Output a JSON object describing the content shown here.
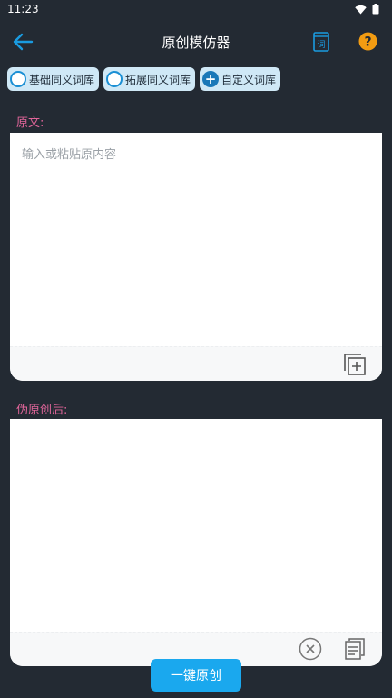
{
  "status": {
    "time": "11:23",
    "icons": [
      "wifi-icon",
      "battery-icon"
    ]
  },
  "app_bar": {
    "title": "原创模仿器",
    "back_icon": "arrow-left-icon",
    "dict_icon": "dictionary-book-icon",
    "dict_icon_text": "词",
    "help_icon": "help-question-icon",
    "help_icon_text": "?"
  },
  "chips": [
    {
      "label": "基础同义词库",
      "icon": "radio-unchecked-icon"
    },
    {
      "label": "拓展同义词库",
      "icon": "radio-unchecked-icon"
    },
    {
      "label": "自定义词库",
      "icon": "plus-circle-icon"
    }
  ],
  "original": {
    "label": "原文:",
    "placeholder": "输入或粘贴原内容",
    "value": "",
    "footer_icon": "paste-add-icon"
  },
  "result": {
    "label": "伪原创后:",
    "value": "",
    "footer_icons": [
      "clear-circle-icon",
      "copy-icon"
    ]
  },
  "action": {
    "label": "一键原创"
  },
  "colors": {
    "background": "#232a33",
    "accent": "#1aa8ee",
    "label": "#e0659a",
    "chip": "#cfe8f6",
    "help": "#f39c12"
  }
}
